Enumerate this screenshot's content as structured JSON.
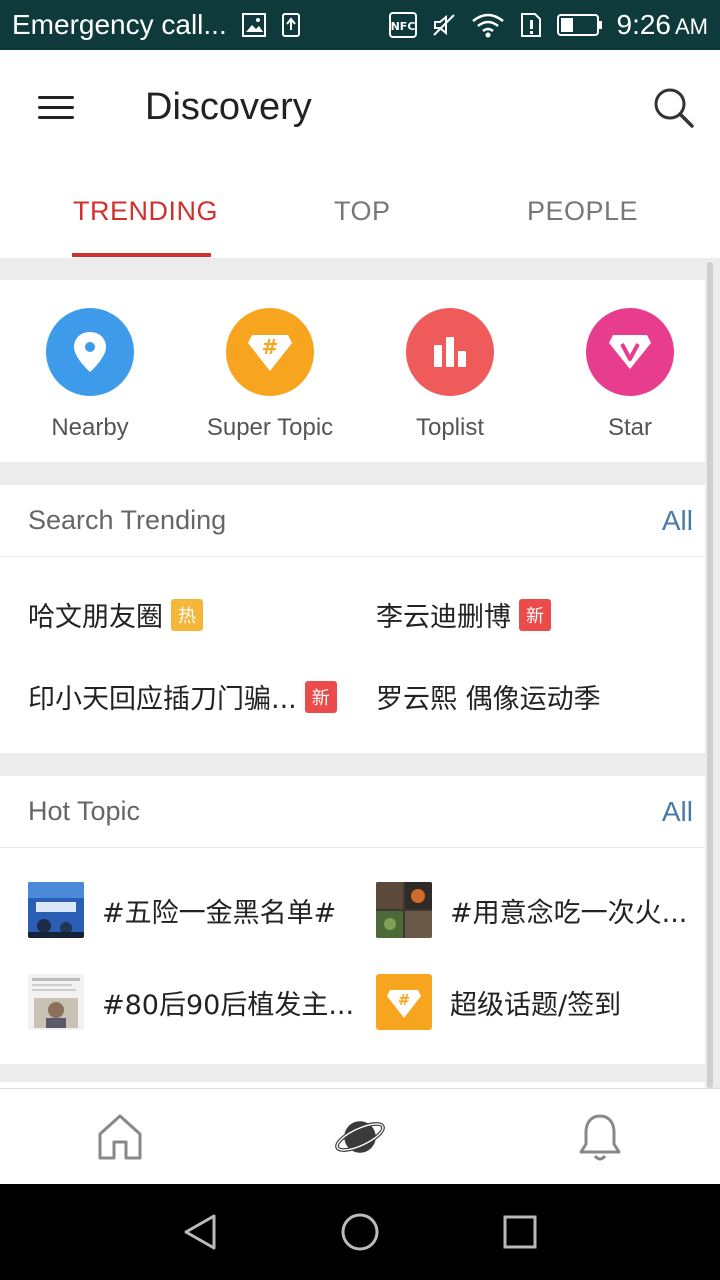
{
  "status_bar": {
    "carrier_text": "Emergency call...",
    "time": "9:26",
    "ampm": "AM",
    "icons": [
      "image-icon",
      "upload-icon",
      "nfc-icon",
      "mute-icon",
      "wifi-icon",
      "sim-icon",
      "battery-icon"
    ]
  },
  "app_bar": {
    "title": "Discovery"
  },
  "tabs": [
    {
      "label": "TRENDING",
      "active": true
    },
    {
      "label": "TOP",
      "active": false
    },
    {
      "label": "PEOPLE",
      "active": false
    }
  ],
  "categories": [
    {
      "label": "Nearby",
      "icon": "location-pin-icon",
      "color": "#3d9be9"
    },
    {
      "label": "Super Topic",
      "icon": "super-topic-icon",
      "color": "#f7a51e"
    },
    {
      "label": "Toplist",
      "icon": "bar-chart-icon",
      "color": "#ef5a5a"
    },
    {
      "label": "Star",
      "icon": "star-v-icon",
      "color": "#e83c8e"
    }
  ],
  "search_trending": {
    "title": "Search Trending",
    "all_label": "All",
    "items": [
      {
        "text": "哈文朋友圈",
        "badge": "热",
        "badge_type": "hot"
      },
      {
        "text": "李云迪删博",
        "badge": "新",
        "badge_type": "new"
      },
      {
        "text": "印小天回应插刀门骗...",
        "badge": "新",
        "badge_type": "new"
      },
      {
        "text": "罗云熙 偶像运动季",
        "badge": "",
        "badge_type": ""
      }
    ]
  },
  "hot_topic": {
    "title": "Hot Topic",
    "all_label": "All",
    "items": [
      {
        "text": "#五险一金黑名单#"
      },
      {
        "text": "#用意念吃一次火..."
      },
      {
        "text": "#80后90后植发主..."
      },
      {
        "text": "超级话题/签到"
      }
    ]
  },
  "bottom_nav": [
    "home-icon",
    "discover-planet-icon",
    "notification-bell-icon"
  ],
  "colors": {
    "accent": "#d2302f",
    "link": "#4a7ba8",
    "status_bar": "#0f3a3c"
  }
}
